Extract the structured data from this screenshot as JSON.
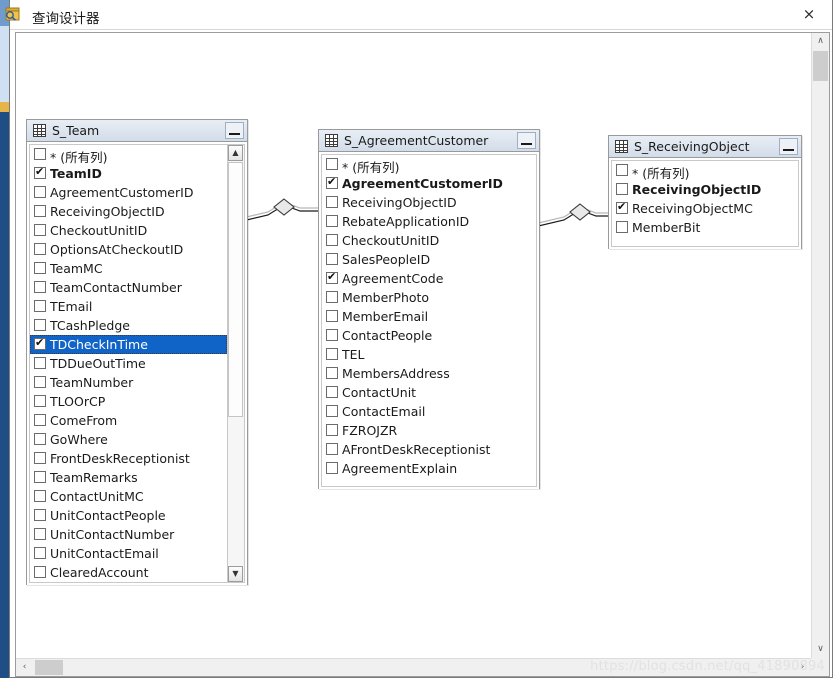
{
  "window": {
    "title": "查询设计器",
    "close_label": "×",
    "icon": "query-designer-icon"
  },
  "watermark": "https://blog.csdn.net/qq_41890894",
  "scrollbars": {
    "v_up": "∧",
    "v_down": "∨",
    "h_left": "‹",
    "h_right": "›",
    "list_up": "▲",
    "list_down": "▼"
  },
  "tables": [
    {
      "name": "S_Team",
      "minimize_label": "_",
      "fields": [
        {
          "label": "* (所有列)",
          "checked": false,
          "bold": false,
          "selected": false
        },
        {
          "label": "TeamID",
          "checked": true,
          "bold": true,
          "selected": false
        },
        {
          "label": "AgreementCustomerID",
          "checked": false,
          "bold": false,
          "selected": false
        },
        {
          "label": "ReceivingObjectID",
          "checked": false,
          "bold": false,
          "selected": false
        },
        {
          "label": "CheckoutUnitID",
          "checked": false,
          "bold": false,
          "selected": false
        },
        {
          "label": "OptionsAtCheckoutID",
          "checked": false,
          "bold": false,
          "selected": false
        },
        {
          "label": "TeamMC",
          "checked": false,
          "bold": false,
          "selected": false
        },
        {
          "label": "TeamContactNumber",
          "checked": false,
          "bold": false,
          "selected": false
        },
        {
          "label": "TEmail",
          "checked": false,
          "bold": false,
          "selected": false
        },
        {
          "label": "TCashPledge",
          "checked": false,
          "bold": false,
          "selected": false
        },
        {
          "label": "TDCheckInTime",
          "checked": true,
          "bold": false,
          "selected": true
        },
        {
          "label": "TDDueOutTime",
          "checked": false,
          "bold": false,
          "selected": false
        },
        {
          "label": "TeamNumber",
          "checked": false,
          "bold": false,
          "selected": false
        },
        {
          "label": "TLOOrCP",
          "checked": false,
          "bold": false,
          "selected": false
        },
        {
          "label": "ComeFrom",
          "checked": false,
          "bold": false,
          "selected": false
        },
        {
          "label": "GoWhere",
          "checked": false,
          "bold": false,
          "selected": false
        },
        {
          "label": "FrontDeskReceptionist",
          "checked": false,
          "bold": false,
          "selected": false
        },
        {
          "label": "TeamRemarks",
          "checked": false,
          "bold": false,
          "selected": false
        },
        {
          "label": "ContactUnitMC",
          "checked": false,
          "bold": false,
          "selected": false
        },
        {
          "label": "UnitContactPeople",
          "checked": false,
          "bold": false,
          "selected": false
        },
        {
          "label": "UnitContactNumber",
          "checked": false,
          "bold": false,
          "selected": false
        },
        {
          "label": "UnitContactEmail",
          "checked": false,
          "bold": false,
          "selected": false
        },
        {
          "label": "ClearedAccount",
          "checked": false,
          "bold": false,
          "selected": false
        }
      ]
    },
    {
      "name": "S_AgreementCustomer",
      "minimize_label": "_",
      "fields": [
        {
          "label": "* (所有列)",
          "checked": false,
          "bold": false,
          "selected": false
        },
        {
          "label": "AgreementCustomerID",
          "checked": true,
          "bold": true,
          "selected": false
        },
        {
          "label": "ReceivingObjectID",
          "checked": false,
          "bold": false,
          "selected": false
        },
        {
          "label": "RebateApplicationID",
          "checked": false,
          "bold": false,
          "selected": false
        },
        {
          "label": "CheckoutUnitID",
          "checked": false,
          "bold": false,
          "selected": false
        },
        {
          "label": "SalesPeopleID",
          "checked": false,
          "bold": false,
          "selected": false
        },
        {
          "label": "AgreementCode",
          "checked": true,
          "bold": false,
          "selected": false
        },
        {
          "label": "MemberPhoto",
          "checked": false,
          "bold": false,
          "selected": false
        },
        {
          "label": "MemberEmail",
          "checked": false,
          "bold": false,
          "selected": false
        },
        {
          "label": "ContactPeople",
          "checked": false,
          "bold": false,
          "selected": false
        },
        {
          "label": "TEL",
          "checked": false,
          "bold": false,
          "selected": false
        },
        {
          "label": "MembersAddress",
          "checked": false,
          "bold": false,
          "selected": false
        },
        {
          "label": "ContactUnit",
          "checked": false,
          "bold": false,
          "selected": false
        },
        {
          "label": "ContactEmail",
          "checked": false,
          "bold": false,
          "selected": false
        },
        {
          "label": "FZROJZR",
          "checked": false,
          "bold": false,
          "selected": false
        },
        {
          "label": "AFrontDeskReceptionist",
          "checked": false,
          "bold": false,
          "selected": false
        },
        {
          "label": "AgreementExplain",
          "checked": false,
          "bold": false,
          "selected": false
        }
      ]
    },
    {
      "name": "S_ReceivingObject",
      "minimize_label": "_",
      "fields": [
        {
          "label": "* (所有列)",
          "checked": false,
          "bold": false,
          "selected": false
        },
        {
          "label": "ReceivingObjectID",
          "checked": false,
          "bold": true,
          "selected": false
        },
        {
          "label": "ReceivingObjectMC",
          "checked": true,
          "bold": false,
          "selected": false
        },
        {
          "label": "MemberBit",
          "checked": false,
          "bold": false,
          "selected": false
        }
      ]
    }
  ],
  "joins": [
    {
      "from": "S_Team",
      "to": "S_AgreementCustomer",
      "type": "inner-join"
    },
    {
      "from": "S_AgreementCustomer",
      "to": "S_ReceivingObject",
      "type": "inner-join"
    }
  ],
  "colors": {
    "selection": "#1064c8",
    "header_gradient_top": "#e8eef5",
    "header_gradient_bottom": "#d3dde9",
    "window_border": "#7a7a7a",
    "watermark": "#e2e2e2"
  }
}
